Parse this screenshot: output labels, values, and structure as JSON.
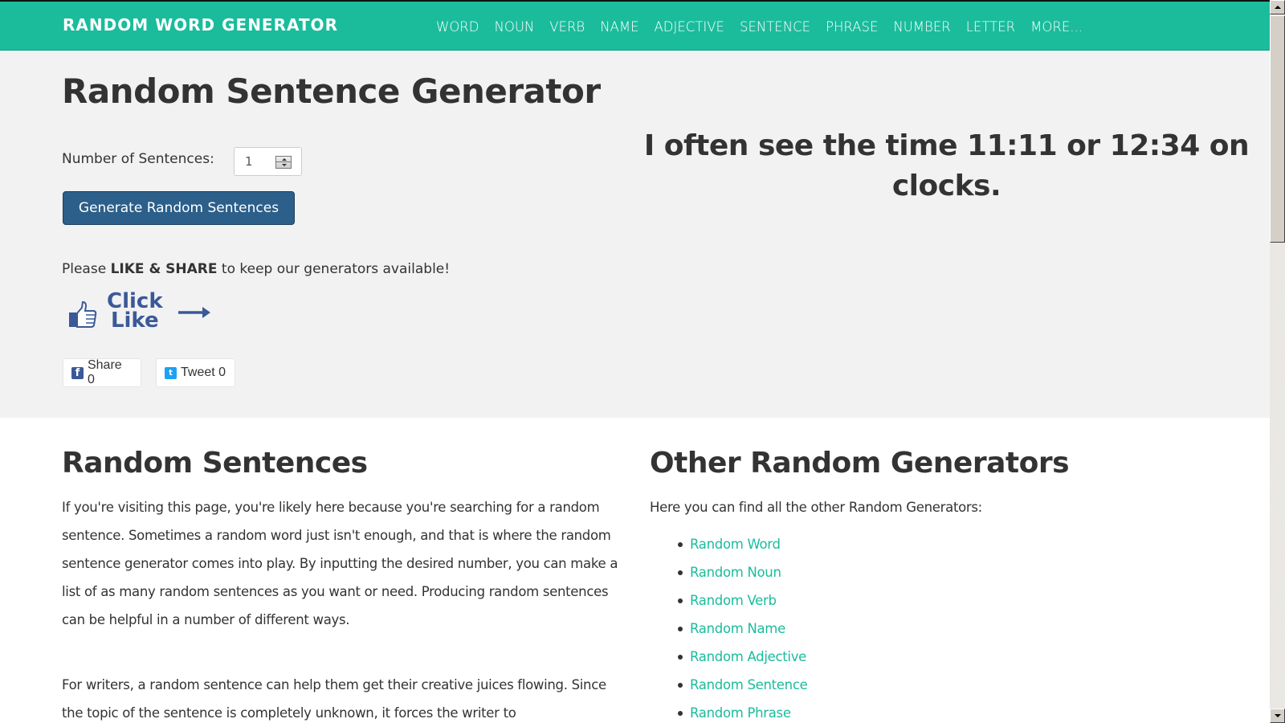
{
  "navbar": {
    "brand": "RANDOM WORD GENERATOR",
    "items": [
      "WORD",
      "NOUN",
      "VERB",
      "NAME",
      "ADJECTIVE",
      "SENTENCE",
      "PHRASE",
      "NUMBER",
      "LETTER",
      "MORE..."
    ]
  },
  "hero": {
    "title": "Random Sentence Generator",
    "number_label": "Number of Sentences:",
    "number_value": "1",
    "generate_button": "Generate Random Sentences",
    "share_prefix": "Please ",
    "share_bold": "LIKE & SHARE",
    "share_suffix": " to keep our generators available!",
    "click_like_line1": "Click",
    "click_like_line2": "Like",
    "facebook_share": "Share 0",
    "twitter_tweet": "Tweet 0",
    "facebook_icon": "f",
    "twitter_icon": "t",
    "generated_sentence": "I often see the time 11:11 or 12:34 on clocks."
  },
  "content": {
    "left_heading": "Random Sentences",
    "paragraph1": "If you're visiting this page, you're likely here because you're searching for a random sentence. Sometimes a random word just isn't enough, and that is where the random sentence generator comes into play. By inputting the desired number, you can make a list of as many random sentences as you want or need. Producing random sentences can be helpful in a number of different ways.",
    "paragraph2": "For writers, a random sentence can help them get their creative juices flowing. Since the topic of the sentence is completely unknown, it forces the writer to",
    "right_heading": "Other Random Generators",
    "right_intro": "Here you can find all the other Random Generators:",
    "generators": [
      "Random Word",
      "Random Noun",
      "Random Verb",
      "Random Name",
      "Random Adjective",
      "Random Sentence",
      "Random Phrase"
    ]
  },
  "colors": {
    "brand_green": "#1abc9c",
    "button_blue": "#2c5f8a",
    "facebook_blue": "#3b5998",
    "twitter_blue": "#1da1f2"
  }
}
